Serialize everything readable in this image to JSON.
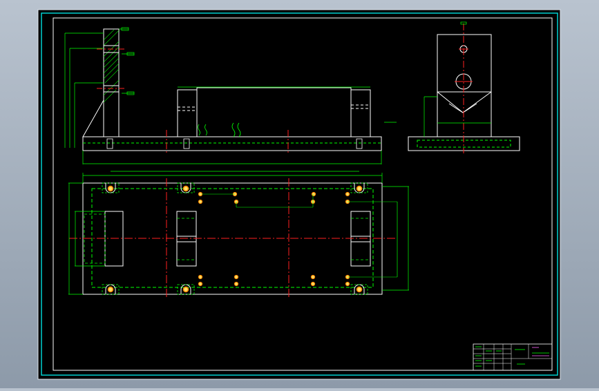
{
  "colors": {
    "background": "#000000",
    "frame": "#ffffff",
    "border_accent": "#00d8d8",
    "part_outline": "#ffffff",
    "dimension": "#00ff00",
    "centerline": "#ff2020",
    "hidden": "#00ff00",
    "hatch": "#00ff00",
    "hole_fill": "#ffe066",
    "hole_ring": "#ff8a00",
    "title_text": "#00ff00",
    "title_text_alt": "#ff66ff"
  },
  "drawing": {
    "views": [
      "front-elevation",
      "side-section",
      "end-view",
      "plan-view"
    ],
    "title_block": {
      "cells": [
        "",
        "",
        "",
        "",
        "",
        ""
      ]
    }
  }
}
